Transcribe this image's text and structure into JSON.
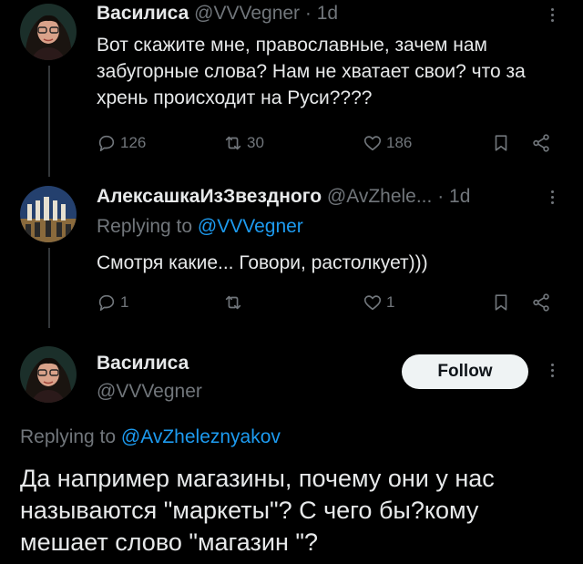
{
  "tweets": [
    {
      "name": "Василиса",
      "handle": "@VVVegner",
      "time": "· 1d",
      "text": "Вот скажите мне, православные, зачем нам забугорные слова? Нам не хватает свои? что за хрень происходит на Руси????",
      "replies": "126",
      "retweets": "30",
      "likes": "186"
    },
    {
      "name": "АлексашкаИзЗвездного",
      "handle": "@AvZhele...",
      "time": "· 1d",
      "replying_prefix": "Replying to ",
      "replying_to": "@VVVegner",
      "text": "Смотря какие... Говори, растолкует)))",
      "replies": "1",
      "retweets": "",
      "likes": "1"
    }
  ],
  "focused": {
    "name": "Василиса",
    "handle": "@VVVegner",
    "follow_label": "Follow",
    "replying_prefix": "Replying to ",
    "replying_to": "@AvZheleznyakov",
    "text": "Да например магазины, почему они у нас называются \"маркеты\"? С чего бы?кому мешает слово \"магазин \"?"
  },
  "colors": {
    "background": "#000000",
    "text": "#e7e9ea",
    "muted": "#71767b",
    "link": "#1d9bf0"
  }
}
